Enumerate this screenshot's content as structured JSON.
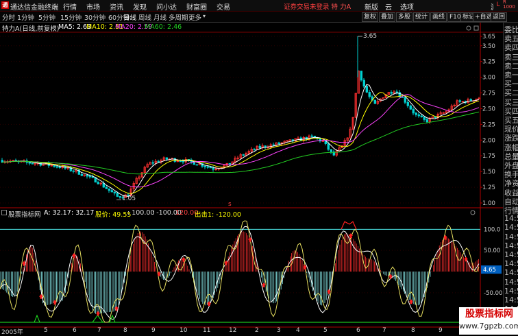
{
  "app": {
    "logo": "通",
    "title": "通达信金融终端"
  },
  "menu": [
    "行情",
    "市场",
    "资讯",
    "发现",
    "问小达",
    "财富圈",
    "交易"
  ],
  "alert": {
    "text": "证券交易未登录",
    "stock": "特 力A"
  },
  "top_right": [
    "新版",
    "云",
    "选项",
    "游客"
  ],
  "lr_badge": "L",
  "lr_badge_small": [
    "R",
    "1000"
  ],
  "periods": [
    "分时",
    "1分钟",
    "5分钟",
    "15分钟",
    "30分钟",
    "60分钟",
    "日线",
    "周线",
    "月线",
    "多周期",
    "更多"
  ],
  "active_period": "日线",
  "tools": [
    "复权",
    "叠加",
    "多股",
    "统计",
    "画线",
    "F10",
    "标记",
    "+自选",
    "返回"
  ],
  "info": {
    "title": "特力A(日线,前复权)",
    "ma5": "MA5: 2.63",
    "ma10": "MA10: 2.61",
    "ma20": "MA20: 2.59",
    "ma60": "MA60: 2.46"
  },
  "colors": {
    "ma5": "#ffffff",
    "ma10": "#ffff00",
    "ma20": "#ff44ff",
    "ma60": "#22cc22",
    "up": "#ff3030",
    "down": "#00d0d0",
    "axis": "#b00000"
  },
  "price_axis": [
    "3.65",
    "3.50",
    "3.25",
    "3.00",
    "2.75",
    "2.50",
    "2.25",
    "2.00",
    "1.75",
    "1.50",
    "1.25",
    "1.00"
  ],
  "price_labels": {
    "high": "3.65",
    "low": "1.05",
    "marker": "s"
  },
  "indicator": {
    "name": "股票指标网",
    "a": "A: 32.17",
    "b": ": 32.17",
    "price": "股价: 49.55",
    "p100": ": 100.00",
    "m100": ": -100.00",
    "v120": "120.00",
    "exit": "出击1: -120.00",
    "axis": [
      "100.0",
      "50.00",
      "-50.00"
    ],
    "current": "4.65"
  },
  "xaxis": [
    "2005年",
    "5",
    "6",
    "7",
    "8",
    "9",
    "10",
    "11",
    "12",
    "2",
    "3",
    "4",
    "5",
    "6",
    "7",
    "8",
    "9"
  ],
  "rightpanel": [
    "委比",
    "卖五",
    "卖四",
    "卖三",
    "卖二",
    "卖一",
    "买一",
    "买二",
    "买三",
    "买四",
    "买五",
    "现价",
    "涨跌",
    "涨幅",
    "总量",
    "外盘",
    "换手",
    "净资",
    "收益",
    "自动",
    "行情",
    "14:50",
    "14:50",
    "14:50",
    "14:50",
    "14:50",
    "14:50",
    "14:50",
    "14:50",
    "14:50",
    "14:50",
    "14:50",
    "14:50"
  ],
  "watermark": {
    "line1": "股票指标网",
    "line2": "www.7gpzb.com"
  }
}
